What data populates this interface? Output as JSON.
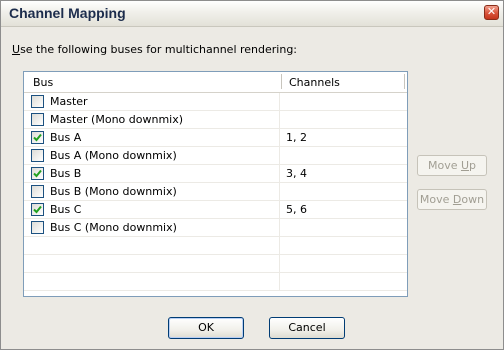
{
  "window": {
    "title": "Channel Mapping"
  },
  "instruction": {
    "mnemonic": "U",
    "rest": "se the following buses for multichannel rendering:"
  },
  "table": {
    "headers": {
      "bus": "Bus",
      "channels": "Channels"
    },
    "rows": [
      {
        "label": "Master",
        "checked": false,
        "channels": ""
      },
      {
        "label": "Master (Mono downmix)",
        "checked": false,
        "channels": ""
      },
      {
        "label": "Bus A",
        "checked": true,
        "channels": "1, 2"
      },
      {
        "label": "Bus A (Mono downmix)",
        "checked": false,
        "channels": ""
      },
      {
        "label": "Bus B",
        "checked": true,
        "channels": "3, 4"
      },
      {
        "label": "Bus B (Mono downmix)",
        "checked": false,
        "channels": ""
      },
      {
        "label": "Bus C",
        "checked": true,
        "channels": "5, 6"
      },
      {
        "label": "Bus C (Mono downmix)",
        "checked": false,
        "channels": ""
      }
    ]
  },
  "buttons": {
    "move_up_pre": "Move ",
    "move_up_key": "U",
    "move_up_post": "p",
    "move_down_pre": "Move ",
    "move_down_key": "D",
    "move_down_post": "own",
    "ok": "OK",
    "cancel": "Cancel"
  },
  "colors": {
    "check": "#21a121",
    "title_text": "#1c2c4c",
    "disabled_text": "#a19e93"
  }
}
